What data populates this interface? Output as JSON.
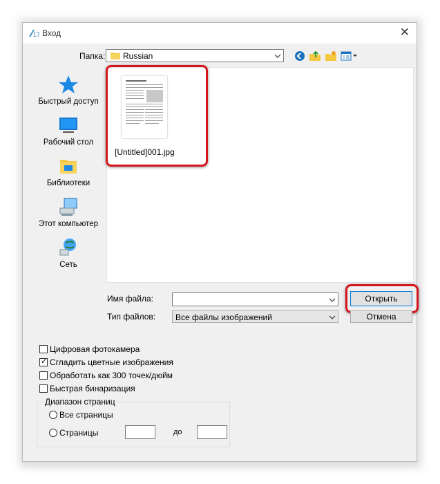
{
  "window": {
    "title": "Вход",
    "app_icon_text": "17"
  },
  "toolbar": {
    "folder_label": "Папка:",
    "folder_value": "Russian"
  },
  "places": [
    {
      "label": "Быстрый доступ",
      "icon": "star-icon"
    },
    {
      "label": "Рабочий стол",
      "icon": "desktop-icon"
    },
    {
      "label": "Библиотеки",
      "icon": "libraries-icon"
    },
    {
      "label": "Этот компьютер",
      "icon": "computer-icon"
    },
    {
      "label": "Сеть",
      "icon": "network-icon"
    }
  ],
  "files": [
    {
      "name": "[Untitled]001.jpg"
    }
  ],
  "filename": {
    "label": "Имя файла:",
    "value": ""
  },
  "filetype": {
    "label": "Тип файлов:",
    "value": "Все файлы изображений"
  },
  "buttons": {
    "open": "Открыть",
    "cancel": "Отмена"
  },
  "options": [
    {
      "label": "Цифровая фотокамера",
      "checked": false
    },
    {
      "label": "Сгладить цветные изображения",
      "checked": true
    },
    {
      "label": "Обработать как 300 точек/дюйм",
      "checked": false
    },
    {
      "label": "Быстрая бинаризация",
      "checked": false
    }
  ],
  "page_range": {
    "title": "Диапазон страниц",
    "all_pages": "Все страницы",
    "pages": "Страницы",
    "to": "до"
  },
  "colors": {
    "highlight": "#d4151c",
    "accent": "#0078d7"
  }
}
